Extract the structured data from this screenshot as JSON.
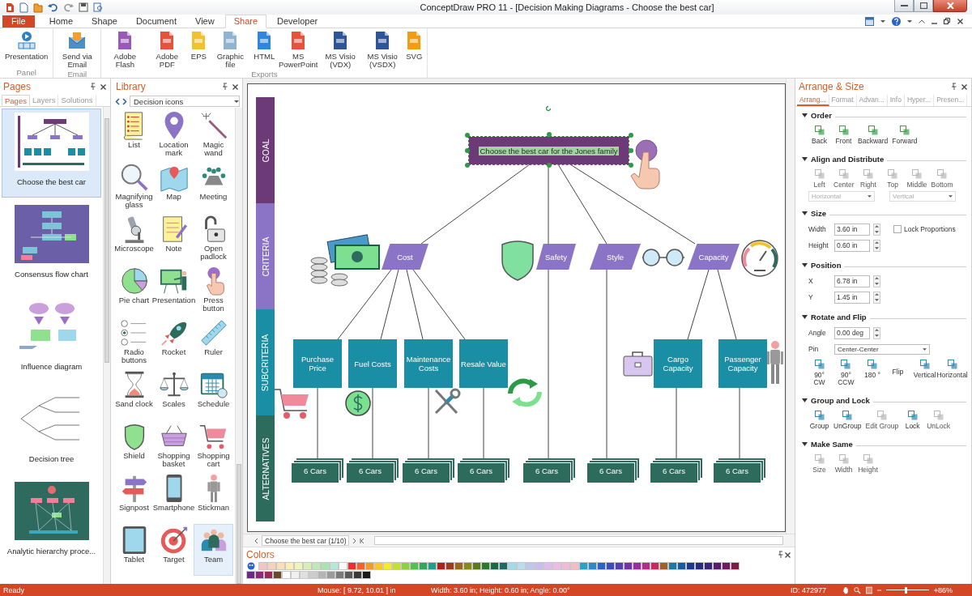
{
  "window": {
    "title": "ConceptDraw PRO 11 - [Decision Making Diagrams - Choose the best car]"
  },
  "ribbon": {
    "tabs": [
      {
        "label": "File",
        "kind": "menu",
        "selected": false
      },
      {
        "label": "Home",
        "kind": "tab",
        "selected": false
      },
      {
        "label": "Shape",
        "kind": "tab",
        "selected": false
      },
      {
        "label": "Document",
        "kind": "tab",
        "selected": false
      },
      {
        "label": "View",
        "kind": "tab",
        "selected": false
      },
      {
        "label": "Share",
        "kind": "tab",
        "selected": true
      },
      {
        "label": "Developer",
        "kind": "tab",
        "selected": false
      }
    ],
    "groups": [
      {
        "label": "Panel",
        "buttons": [
          "Presentation"
        ]
      },
      {
        "label": "Email",
        "buttons": [
          "Send via Email"
        ]
      },
      {
        "label": "Exports",
        "buttons": [
          "Adobe Flash",
          "Adobe PDF",
          "EPS",
          "Graphic file",
          "HTML",
          "MS PowerPoint",
          "MS Visio (VDX)",
          "MS Visio (VSDX)",
          "SVG"
        ]
      }
    ]
  },
  "pages_panel": {
    "title": "Pages",
    "tabs": [
      {
        "label": "Pages",
        "selected": true
      },
      {
        "label": "Layers",
        "selected": false
      },
      {
        "label": "Solutions",
        "selected": false
      }
    ],
    "pages": [
      {
        "label": "Choose the best car",
        "selected": true
      },
      {
        "label": "Consensus flow chart",
        "selected": false
      },
      {
        "label": "Influence diagram",
        "selected": false
      },
      {
        "label": "Decision tree",
        "selected": false
      },
      {
        "label": "Analytic hierarchy proce...",
        "selected": false
      }
    ]
  },
  "library": {
    "title": "Library",
    "dropdown": "Decision icons",
    "items": [
      {
        "label": "List",
        "selected": false
      },
      {
        "label": "Location mark",
        "selected": false
      },
      {
        "label": "Magic wand",
        "selected": false
      },
      {
        "label": "Magnifying glass",
        "selected": false
      },
      {
        "label": "Map",
        "selected": false
      },
      {
        "label": "Meeting",
        "selected": false
      },
      {
        "label": "Microscope",
        "selected": false
      },
      {
        "label": "Note",
        "selected": false
      },
      {
        "label": "Open padlock",
        "selected": false
      },
      {
        "label": "Pie chart",
        "selected": false
      },
      {
        "label": "Presentation",
        "selected": false
      },
      {
        "label": "Press button",
        "selected": false
      },
      {
        "label": "Radio buttons",
        "selected": false
      },
      {
        "label": "Rocket",
        "selected": false
      },
      {
        "label": "Ruler",
        "selected": false
      },
      {
        "label": "Sand clock",
        "selected": false
      },
      {
        "label": "Scales",
        "selected": false
      },
      {
        "label": "Schedule",
        "selected": false
      },
      {
        "label": "Shield",
        "selected": false
      },
      {
        "label": "Shopping basket",
        "selected": false
      },
      {
        "label": "Shopping cart",
        "selected": false
      },
      {
        "label": "Signpost",
        "selected": false
      },
      {
        "label": "Smartphone",
        "selected": false
      },
      {
        "label": "Stickman",
        "selected": false
      },
      {
        "label": "Tablet",
        "selected": false
      },
      {
        "label": "Target",
        "selected": false
      },
      {
        "label": "Team",
        "selected": true
      }
    ]
  },
  "diagram": {
    "lanes": [
      "GOAL",
      "CRITERIA",
      "SUBCRITERIA",
      "ALTERNATIVES"
    ],
    "goal": {
      "text": "Choose the best car for the Jones family",
      "selected": true
    },
    "criteria": [
      "Cost",
      "Safety",
      "Style",
      "Capacity"
    ],
    "subcriteria": [
      "Purchase Price",
      "Fuel Costs",
      "Maintenance Costs",
      "Resale Value",
      "Cargo Capacity",
      "Passenger Capacity"
    ],
    "alternatives": [
      "6 Cars",
      "6 Cars",
      "6 Cars",
      "6 Cars",
      "6 Cars",
      "6 Cars",
      "6 Cars",
      "6 Cars"
    ]
  },
  "page_nav": {
    "page": "Choose the best car (1/10)"
  },
  "colors_panel": {
    "title": "Colors",
    "rows": [
      {
        "swatches": [
          {
            "color": "#f4c4c4"
          },
          {
            "color": "#f7d2b8"
          },
          {
            "color": "#f9e0b4"
          },
          {
            "color": "#fbedb4"
          },
          {
            "color": "#eef5b6"
          },
          {
            "color": "#d7efb4"
          },
          {
            "color": "#bfe9b8"
          },
          {
            "color": "#a8e4b0"
          },
          {
            "color": "#b4e8d8"
          },
          {
            "color": "#fafafa"
          },
          {
            "color": "#e8302c"
          },
          {
            "color": "#f0642a"
          },
          {
            "color": "#f59a26"
          },
          {
            "color": "#f7c826"
          },
          {
            "color": "#f4ec2a"
          },
          {
            "color": "#c4e02c"
          },
          {
            "color": "#8ed23a"
          },
          {
            "color": "#52c248"
          },
          {
            "color": "#2eaa5a"
          },
          {
            "color": "#20a08a"
          },
          {
            "color": "#b0201e"
          },
          {
            "color": "#a03c1c"
          },
          {
            "color": "#9a6a18"
          },
          {
            "color": "#8a8a18"
          },
          {
            "color": "#5a7a1c"
          },
          {
            "color": "#2a7a2c"
          },
          {
            "color": "#1c6a44"
          },
          {
            "color": "#1c6a64"
          },
          {
            "color": "#9edce8"
          },
          {
            "color": "#b8dcf0"
          },
          {
            "color": "#bcc8ee"
          },
          {
            "color": "#cabcee"
          },
          {
            "color": "#dcbcec"
          },
          {
            "color": "#ecbce4"
          },
          {
            "color": "#f0bcd4"
          },
          {
            "color": "#f4bcc4"
          },
          {
            "color": "#26a4c8"
          },
          {
            "color": "#2a8ad0"
          },
          {
            "color": "#2a64c8"
          },
          {
            "color": "#3a4cc0"
          },
          {
            "color": "#5440b4"
          },
          {
            "color": "#7432a8"
          },
          {
            "color": "#9a2ca0"
          },
          {
            "color": "#b82a88"
          },
          {
            "color": "#c82a60"
          },
          {
            "color": "#a0602a"
          },
          {
            "color": "#1a7aa0"
          },
          {
            "color": "#1a5aa0"
          },
          {
            "color": "#1a3c90"
          },
          {
            "color": "#282c80"
          },
          {
            "color": "#3c2478"
          },
          {
            "color": "#5a1c70"
          },
          {
            "color": "#701a64"
          },
          {
            "color": "#801a44"
          }
        ]
      },
      {
        "swatches": [
          {
            "color": "#6a2a8a"
          },
          {
            "color": "#8a2a7a"
          },
          {
            "color": "#9a2a5a"
          },
          {
            "color": "#6a4a2a"
          },
          {
            "color": "#ffffff"
          },
          {
            "color": "#f0f0f0"
          },
          {
            "color": "#e0e0e0"
          },
          {
            "color": "#cccccc"
          },
          {
            "color": "#b4b4b4"
          },
          {
            "color": "#9a9a9a"
          },
          {
            "color": "#7a7a7a"
          },
          {
            "color": "#5a5a5a"
          },
          {
            "color": "#3a3a3a"
          },
          {
            "color": "#1a1a1a"
          }
        ]
      }
    ]
  },
  "arrange_panel": {
    "title": "Arrange & Size",
    "tabs": [
      {
        "label": "Arrang...",
        "selected": true
      },
      {
        "label": "Format",
        "selected": false
      },
      {
        "label": "Advan...",
        "selected": false
      },
      {
        "label": "Info",
        "selected": false
      },
      {
        "label": "Hyper...",
        "selected": false
      },
      {
        "label": "Presen...",
        "selected": false
      }
    ],
    "sections": [
      {
        "title": "Order",
        "expanded": true,
        "rows": [
          {
            "kind": "buttons",
            "buttons": [
              {
                "label": "Back",
                "disabled": false
              },
              {
                "label": "Front",
                "disabled": false
              },
              {
                "label": "Backward",
                "disabled": false
              },
              {
                "label": "Forward",
                "disabled": false
              }
            ]
          }
        ]
      },
      {
        "title": "Align and Distribute",
        "expanded": true,
        "rows": [
          {
            "kind": "buttons",
            "buttons": [
              {
                "label": "Left",
                "disabled": true
              },
              {
                "label": "Center",
                "disabled": true
              },
              {
                "label": "Right",
                "disabled": true
              },
              {
                "label": "Top",
                "disabled": true
              },
              {
                "label": "Middle",
                "disabled": true
              },
              {
                "label": "Bottom",
                "disabled": true
              }
            ]
          },
          {
            "kind": "selects",
            "selects": [
              {
                "value": "Horizontal",
                "disabled": true
              },
              {
                "value": "Vertical",
                "disabled": true
              }
            ]
          }
        ]
      },
      {
        "title": "Size",
        "expanded": true,
        "rows": [
          {
            "kind": "spin",
            "label": "Width",
            "value": "3.60 in",
            "checkbox": {
              "label": "Lock Proportions",
              "checked": false
            }
          },
          {
            "kind": "spin",
            "label": "Height",
            "value": "0.60 in"
          }
        ]
      },
      {
        "title": "Position",
        "expanded": true,
        "rows": [
          {
            "kind": "spin",
            "label": "X",
            "value": "6.78 in"
          },
          {
            "kind": "spin",
            "label": "Y",
            "value": "1.45 in"
          }
        ]
      },
      {
        "title": "Rotate and Flip",
        "expanded": true,
        "rows": [
          {
            "kind": "spin",
            "label": "Angle",
            "value": "0.00 deg"
          },
          {
            "kind": "select",
            "label": "Pin",
            "value": "Center-Center"
          },
          {
            "kind": "buttons",
            "buttons": [
              {
                "label": "90° CW",
                "disabled": false
              },
              {
                "label": "90° CCW",
                "disabled": false
              },
              {
                "label": "180 °",
                "disabled": false
              },
              {
                "label": "Flip",
                "kind": "caption"
              },
              {
                "label": "Vertical",
                "disabled": false
              },
              {
                "label": "Horizontal",
                "disabled": false
              }
            ]
          }
        ]
      },
      {
        "title": "Group and Lock",
        "expanded": true,
        "rows": [
          {
            "kind": "buttons",
            "buttons": [
              {
                "label": "Group",
                "disabled": false
              },
              {
                "label": "UnGroup",
                "disabled": false
              },
              {
                "label": "Edit Group",
                "disabled": true
              },
              {
                "label": "Lock",
                "disabled": false
              },
              {
                "label": "UnLock",
                "disabled": true
              }
            ]
          }
        ]
      },
      {
        "title": "Make Same",
        "expanded": true,
        "rows": [
          {
            "kind": "buttons",
            "buttons": [
              {
                "label": "Size",
                "disabled": true
              },
              {
                "label": "Width",
                "disabled": true
              },
              {
                "label": "Height",
                "disabled": true
              }
            ]
          }
        ]
      }
    ]
  },
  "status_bar": {
    "status": "Ready",
    "mouse": "Mouse: [ 9.72, 10.01 ] in",
    "shape": "Width: 3.60 in;  Height: 0.60 in;  Angle: 0.00°",
    "id": "ID: 472977",
    "zoom_slider": {
      "level": 0.45
    },
    "zoom": "86%"
  }
}
